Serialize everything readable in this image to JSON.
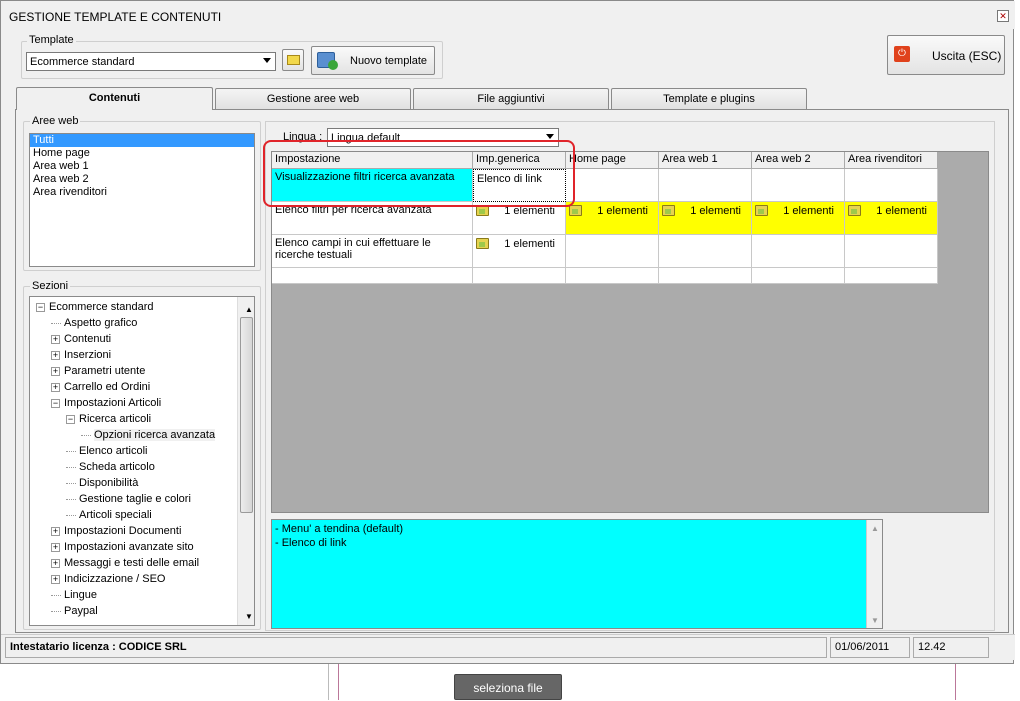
{
  "window": {
    "title": "GESTIONE TEMPLATE E CONTENUTI",
    "close": "✕"
  },
  "template": {
    "label": "Template",
    "selected": "Ecommerce standard",
    "new_button": "Nuovo template"
  },
  "exit_button": "Uscita (ESC)",
  "tabs": [
    "Contenuti",
    "Gestione aree web",
    "File aggiuntivi",
    "Template e plugins"
  ],
  "aree_web": {
    "label": "Aree web",
    "items": [
      "Tutti",
      "Home page",
      "Area web 1",
      "Area web 2",
      "Area rivenditori"
    ]
  },
  "sezioni": {
    "label": "Sezioni",
    "tree": [
      {
        "text": "Ecommerce standard",
        "level": 0,
        "exp": "−"
      },
      {
        "text": "Aspetto grafico",
        "level": 1,
        "exp": ""
      },
      {
        "text": "Contenuti",
        "level": 1,
        "exp": "+"
      },
      {
        "text": "Inserzioni",
        "level": 1,
        "exp": "+"
      },
      {
        "text": "Parametri utente",
        "level": 1,
        "exp": "+"
      },
      {
        "text": "Carrello ed Ordini",
        "level": 1,
        "exp": "+"
      },
      {
        "text": "Impostazioni Articoli",
        "level": 1,
        "exp": "−"
      },
      {
        "text": "Ricerca articoli",
        "level": 2,
        "exp": "−"
      },
      {
        "text": "Opzioni ricerca avanzata",
        "level": 3,
        "exp": ""
      },
      {
        "text": "Elenco articoli",
        "level": 2,
        "exp": ""
      },
      {
        "text": "Scheda articolo",
        "level": 2,
        "exp": ""
      },
      {
        "text": "Disponibilità",
        "level": 2,
        "exp": ""
      },
      {
        "text": "Gestione taglie e colori",
        "level": 2,
        "exp": ""
      },
      {
        "text": "Articoli speciali",
        "level": 2,
        "exp": ""
      },
      {
        "text": "Impostazioni Documenti",
        "level": 1,
        "exp": "+"
      },
      {
        "text": "Impostazioni avanzate sito",
        "level": 1,
        "exp": "+"
      },
      {
        "text": "Messaggi e testi delle email",
        "level": 1,
        "exp": "+"
      },
      {
        "text": "Indicizzazione / SEO",
        "level": 1,
        "exp": "+"
      },
      {
        "text": "Lingue",
        "level": 1,
        "exp": ""
      },
      {
        "text": "Paypal",
        "level": 1,
        "exp": ""
      }
    ]
  },
  "lingua": {
    "label": "Lingua :",
    "selected": "Lingua default"
  },
  "grid": {
    "headers": [
      "Impostazione",
      "Imp.generica",
      "Home page",
      "Area web 1",
      "Area web 2",
      "Area rivenditori"
    ],
    "rows": [
      {
        "name": "Visualizzazione filtri ricerca avanzata",
        "generic": "Elenco di link"
      },
      {
        "name": "Elenco filtri per ricerca avanzata",
        "cells": [
          "1 elementi",
          "1 elementi",
          "1 elementi",
          "1 elementi",
          "1 elementi"
        ]
      },
      {
        "name": "Elenco campi in cui effettuare le ricerche testuali",
        "cells": [
          "1 elementi"
        ]
      }
    ]
  },
  "options": [
    "- Menu' a tendina (default)",
    "- Elenco di link"
  ],
  "status": {
    "license": "Intestatario licenza : CODICE SRL",
    "date": "01/06/2011",
    "time": "12.42"
  },
  "background": {
    "file_button": "seleziona file"
  }
}
